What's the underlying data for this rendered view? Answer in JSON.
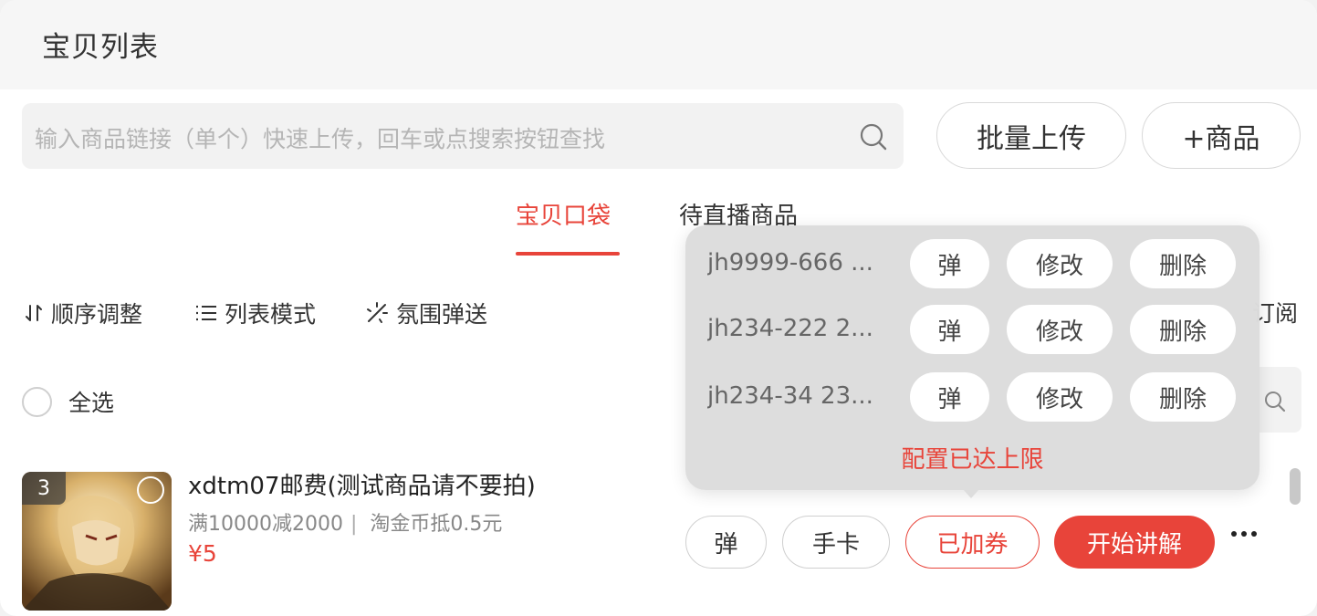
{
  "header": {
    "title": "宝贝列表"
  },
  "search": {
    "placeholder": "输入商品链接（单个）快速上传，回车或点搜索按钮查找"
  },
  "actions": {
    "batch_upload": "批量上传",
    "add_product": "+商品"
  },
  "tabs": [
    {
      "label": "宝贝口袋",
      "active": true
    },
    {
      "label": "待直播商品",
      "active": false
    }
  ],
  "toolbar": {
    "order": "顺序调整",
    "list_mode": "列表模式",
    "ambience": "氛围弹送",
    "subscribe_partial": "订阅"
  },
  "select_all": "全选",
  "product": {
    "index": "3",
    "title": "xdtm07邮费(测试商品请不要拍)",
    "promo": "满10000减2000",
    "promo_sep": "|",
    "coin": "淘金币抵0.5元",
    "price": "¥5",
    "buttons": {
      "pop": "弹",
      "card": "手卡",
      "coupon": "已加券",
      "explain": "开始讲解"
    }
  },
  "popup": {
    "rows": [
      {
        "name": "jh9999-666 ...",
        "pop": "弹",
        "edit": "修改",
        "delete": "删除"
      },
      {
        "name": "jh234-222 2...",
        "pop": "弹",
        "edit": "修改",
        "delete": "删除"
      },
      {
        "name": "jh234-34 23...",
        "pop": "弹",
        "edit": "修改",
        "delete": "删除"
      }
    ],
    "limit_text": "配置已达上限"
  },
  "colors": {
    "accent": "#e8443a",
    "border": "#d9d9d9",
    "popup_bg": "#dcdcdc"
  }
}
